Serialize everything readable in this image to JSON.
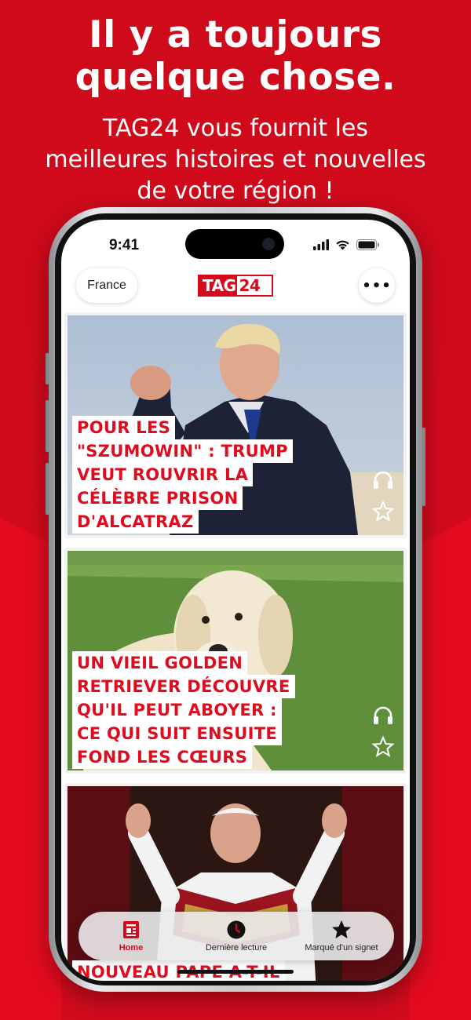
{
  "promo": {
    "headline_line1": "Il y a toujours",
    "headline_line2": "quelque chose.",
    "sub_line1": "TAG24 vous fournit les",
    "sub_line2": "meilleures histoires et nouvelles",
    "sub_line3": "de votre région !"
  },
  "colors": {
    "brand_red": "#d70a1d",
    "headline_red": "#e00b1e"
  },
  "status_bar": {
    "time": "9:41",
    "icons": [
      "signal-icon",
      "wifi-icon",
      "battery-icon"
    ]
  },
  "header": {
    "region_label": "France",
    "logo_part1": "TAG",
    "logo_part2": "24",
    "more_label": "•••"
  },
  "articles": [
    {
      "title_lines": [
        "POUR LES",
        "\"SZUMOWIN\" : TRUMP",
        "VEUT ROUVRIR LA",
        "CÉLÈBRE PRISON",
        "D'ALCATRAZ"
      ],
      "icons": [
        "headphones-icon",
        "star-outline-icon"
      ]
    },
    {
      "title_lines": [
        "UN VIEIL GOLDEN",
        "RETRIEVER DÉCOUVRE",
        "QU'IL PEUT ABOYER :",
        "CE QUI SUIT ENSUITE",
        "FOND LES CŒURS"
      ],
      "icons": [
        "headphones-icon",
        "star-outline-icon"
      ]
    },
    {
      "title_lines": [
        "NOUVEAU PAPE A-T-IL"
      ],
      "icons": []
    }
  ],
  "tabbar": {
    "tabs": [
      {
        "label": "Home",
        "icon": "newspaper-icon",
        "active": true
      },
      {
        "label": "Dernière lecture",
        "icon": "clock-icon",
        "active": false
      },
      {
        "label": "Marqué d'un signet",
        "icon": "star-filled-icon",
        "active": false
      }
    ]
  }
}
